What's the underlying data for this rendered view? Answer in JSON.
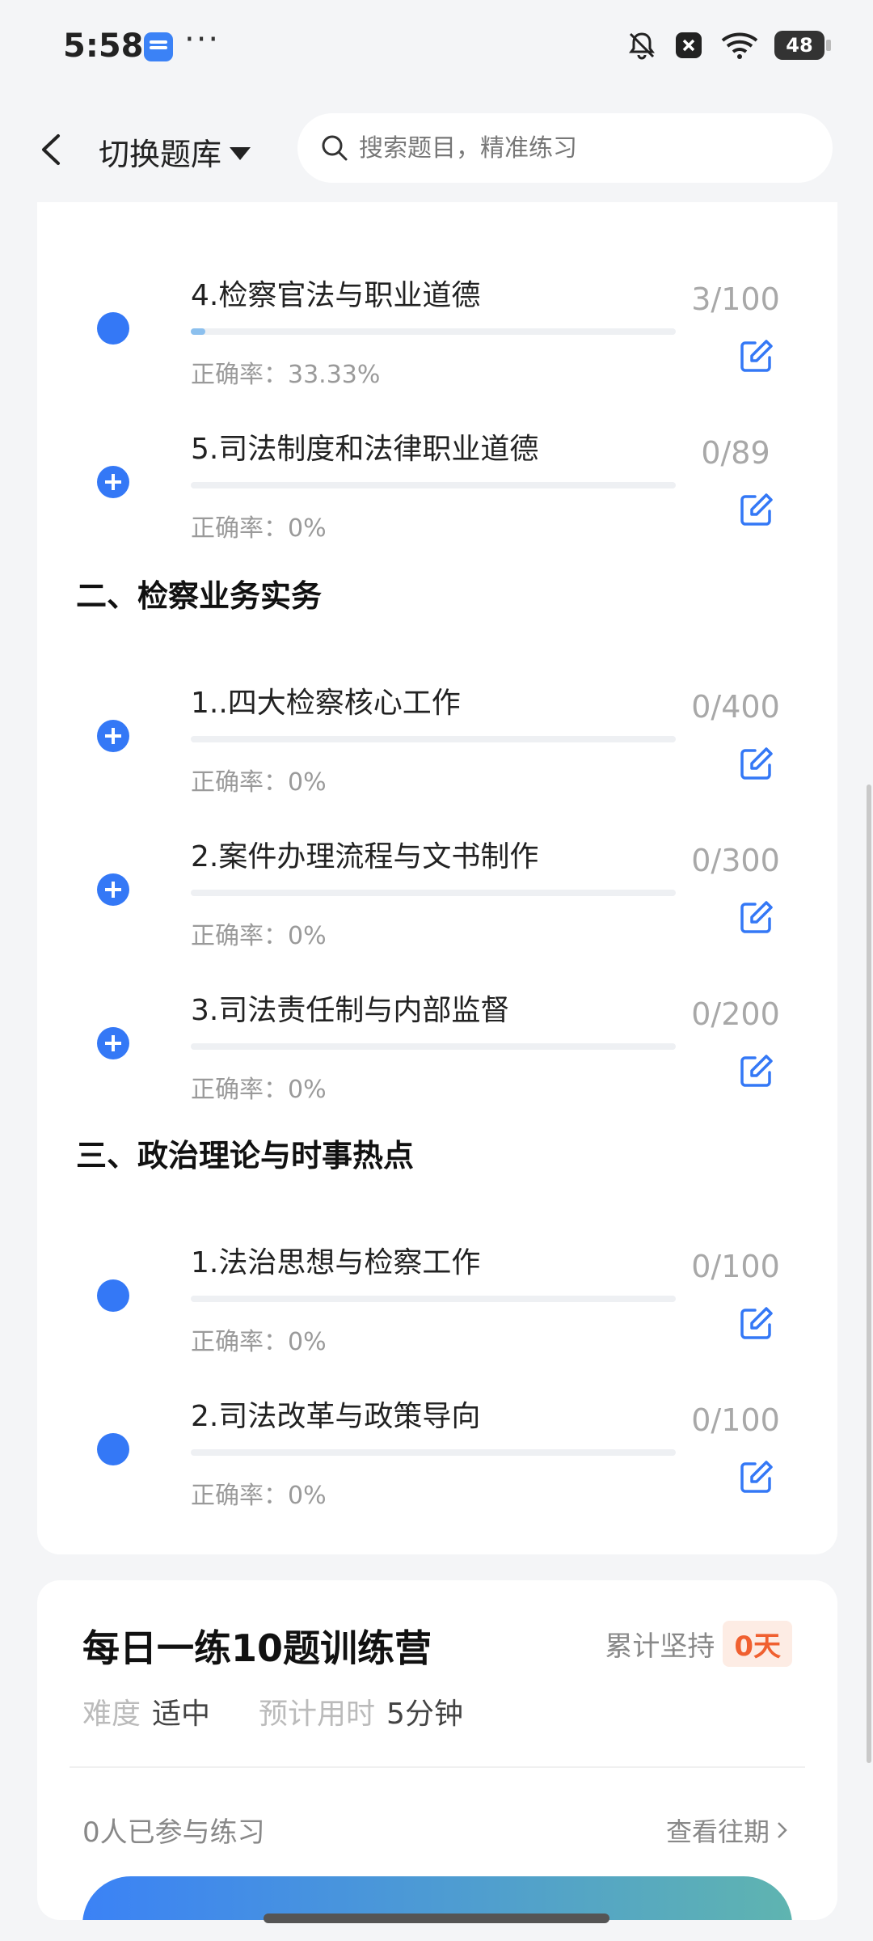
{
  "status_bar": {
    "time": "5:58",
    "dots": "···",
    "battery": "48",
    "icons": [
      "bell-muted-icon",
      "close-box-icon",
      "wifi-icon",
      "battery-icon"
    ]
  },
  "header": {
    "switch_label": "切换题库",
    "search_placeholder": "搜索题目，精准练习"
  },
  "sections": [
    {
      "title": "",
      "items": [
        {
          "title": "",
          "rate": "正确率：0%",
          "count": "",
          "progress": 0,
          "icon": "hidden"
        },
        {
          "title": "4.检察官法与职业道德",
          "rate": "正确率：33.33%",
          "count": "3/100",
          "progress": 0.03,
          "icon": "dot"
        },
        {
          "title": "5.司法制度和法律职业道德",
          "rate": "正确率：0%",
          "count": "0/89",
          "progress": 0,
          "icon": "plus"
        }
      ]
    },
    {
      "title": "二、检察业务实务",
      "items": [
        {
          "title": "1..四大检察核心工作",
          "rate": "正确率：0%",
          "count": "0/400",
          "progress": 0,
          "icon": "plus"
        },
        {
          "title": "2.案件办理流程与文书制作",
          "rate": "正确率：0%",
          "count": "0/300",
          "progress": 0,
          "icon": "plus"
        },
        {
          "title": "3.司法责任制与内部监督",
          "rate": "正确率：0%",
          "count": "0/200",
          "progress": 0,
          "icon": "plus"
        }
      ]
    },
    {
      "title": "三、政治理论与时事热点",
      "items": [
        {
          "title": "1.法治思想与检察工作",
          "rate": "正确率：0%",
          "count": "0/100",
          "progress": 0,
          "icon": "dot"
        },
        {
          "title": "2.司法改革与政策导向",
          "rate": "正确率：0%",
          "count": "0/100",
          "progress": 0,
          "icon": "dot"
        }
      ]
    }
  ],
  "training": {
    "title": "每日一练10题训练营",
    "persist_label": "累计坚持",
    "persist_value": "0天",
    "difficulty_label": "难度",
    "difficulty_value": "适中",
    "time_label": "预计用时",
    "time_value": "5分钟",
    "joined": "0人已参与练习",
    "history": "查看往期"
  },
  "colors": {
    "accent": "#3478f6",
    "badge_text": "#f06030",
    "badge_bg": "#fdece4"
  }
}
